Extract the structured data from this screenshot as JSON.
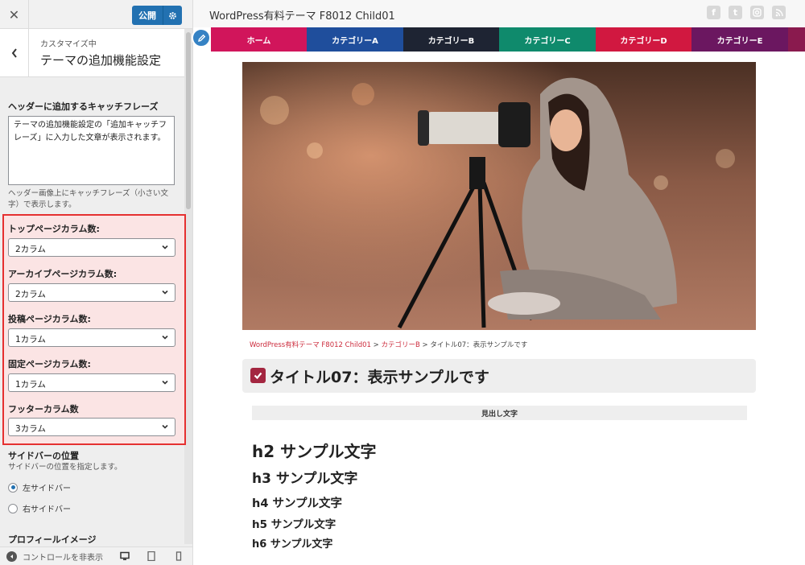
{
  "panel": {
    "close_icon": "close-icon",
    "publish_label": "公開",
    "section_sub": "カスタマイズ中",
    "section_title": "テーマの追加機能設定",
    "catchphrase": {
      "label": "ヘッダーに追加するキャッチフレーズ",
      "value": "テーマの追加機能設定の「追加キャッチフレーズ」に入力した文章が表示されます。",
      "hint": "ヘッダー画像上にキャッチフレーズ（小さい文字）で表示します。"
    },
    "columns": [
      {
        "label": "トップページカラム数:",
        "value": "2カラム"
      },
      {
        "label": "アーカイブページカラム数:",
        "value": "2カラム"
      },
      {
        "label": "投稿ページカラム数:",
        "value": "1カラム"
      },
      {
        "label": "固定ページカラム数:",
        "value": "1カラム"
      },
      {
        "label": "フッターカラム数",
        "value": "3カラム"
      }
    ],
    "sidebar": {
      "label": "サイドバーの位置",
      "hint": "サイドバーの位置を指定します。",
      "options": [
        "左サイドバー",
        "右サイドバー"
      ],
      "selected": "左サイドバー"
    },
    "profile_label": "プロフィールイメージ",
    "footer": {
      "toggle_label": "コントロールを非表示"
    }
  },
  "preview": {
    "site_title": "WordPress有料テーマ F8012 Child01",
    "nav": [
      {
        "label": "ホーム",
        "color": "#d1155b"
      },
      {
        "label": "カテゴリーA",
        "color": "#1f4e9c"
      },
      {
        "label": "カテゴリーB",
        "color": "#1e2433"
      },
      {
        "label": "カテゴリーC",
        "color": "#0f8a6c"
      },
      {
        "label": "カテゴリーD",
        "color": "#d11840"
      },
      {
        "label": "カテゴリーE",
        "color": "#6b1760"
      }
    ],
    "breadcrumb": {
      "home": "WordPress有料テーマ F8012 Child01",
      "sep1": " > ",
      "category": "カテゴリーB",
      "sep2": " > ",
      "current": "タイトル07：表示サンプルです"
    },
    "post_title": "タイトル07：表示サンプルです",
    "midashi": "見出し文字",
    "headings": {
      "h2": "h2 サンプル文字",
      "h3": "h3 サンプル文字",
      "h4": "h4 サンプル文字",
      "h5": "h5 サンプル文字",
      "h6": "h6 サンプル文字"
    }
  }
}
